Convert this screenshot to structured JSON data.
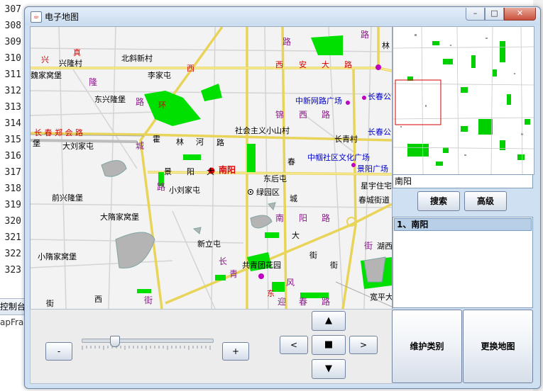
{
  "background": {
    "line_numbers": [
      "307",
      "308",
      "309",
      "310",
      "311",
      "312",
      "313",
      "314",
      "315",
      "316",
      "317",
      "318",
      "319",
      "320",
      "321",
      "322",
      "323"
    ],
    "tab_label": "控制台",
    "tab_label_2": "apFrame"
  },
  "window": {
    "title": "电子地图",
    "minimize_glyph": "–",
    "maximize_glyph": "□",
    "close_glyph": "✕"
  },
  "map": {
    "labels": [
      {
        "t": "真",
        "c": "red"
      },
      {
        "t": "北斜新村",
        "c": ""
      },
      {
        "t": "路",
        "c": "road"
      },
      {
        "t": "路",
        "c": "road"
      },
      {
        "t": "林",
        "c": ""
      },
      {
        "t": "兴",
        "c": "red"
      },
      {
        "t": "兴隆村",
        "c": ""
      },
      {
        "t": "西",
        "c": "red"
      },
      {
        "t": "西",
        "c": "red"
      },
      {
        "t": "安",
        "c": "red"
      },
      {
        "t": "大",
        "c": "red"
      },
      {
        "t": "路",
        "c": "red"
      },
      {
        "t": "魏家窝堡",
        "c": ""
      },
      {
        "t": "李家屯",
        "c": ""
      },
      {
        "t": "隆",
        "c": "road"
      },
      {
        "t": "东兴隆堡",
        "c": ""
      },
      {
        "t": "路",
        "c": "road"
      },
      {
        "t": "环",
        "c": "red"
      },
      {
        "t": "中新网路广场",
        "c": "blue"
      },
      {
        "t": "长春公",
        "c": "blue"
      },
      {
        "t": "锦",
        "c": "road"
      },
      {
        "t": "西",
        "c": "road"
      },
      {
        "t": "路",
        "c": "road"
      },
      {
        "t": "长 春 郑 会 路",
        "c": "red"
      },
      {
        "t": "霍",
        "c": ""
      },
      {
        "t": "林",
        "c": ""
      },
      {
        "t": "河",
        "c": ""
      },
      {
        "t": "路",
        "c": ""
      },
      {
        "t": "社会主义小山村",
        "c": ""
      },
      {
        "t": "堡",
        "c": ""
      },
      {
        "t": "大刘家屯",
        "c": ""
      },
      {
        "t": "城",
        "c": "road"
      },
      {
        "t": "长青村",
        "c": ""
      },
      {
        "t": "长春公",
        "c": "blue"
      },
      {
        "t": "春",
        "c": ""
      },
      {
        "t": "中帼社区文化广场",
        "c": "blue"
      },
      {
        "t": "景",
        "c": ""
      },
      {
        "t": "阳",
        "c": ""
      },
      {
        "t": "大",
        "c": ""
      },
      {
        "t": "南阳",
        "c": "big"
      },
      {
        "t": "东后屯",
        "c": ""
      },
      {
        "t": "景阳广场",
        "c": "blue"
      },
      {
        "t": "路",
        "c": "road"
      },
      {
        "t": "小刘家屯",
        "c": ""
      },
      {
        "t": "绿园区",
        "c": ""
      },
      {
        "t": "星宇住宅",
        "c": ""
      },
      {
        "t": "前兴隆堡",
        "c": ""
      },
      {
        "t": "城",
        "c": ""
      },
      {
        "t": "春城街道",
        "c": ""
      },
      {
        "t": "大隋家窝堡",
        "c": ""
      },
      {
        "t": "南",
        "c": "road"
      },
      {
        "t": "阳",
        "c": "road"
      },
      {
        "t": "路",
        "c": "road"
      },
      {
        "t": "大",
        "c": ""
      },
      {
        "t": "新立屯",
        "c": ""
      },
      {
        "t": "街",
        "c": "road"
      },
      {
        "t": "湖西",
        "c": ""
      },
      {
        "t": "小隋家窝堡",
        "c": ""
      },
      {
        "t": "长",
        "c": "road"
      },
      {
        "t": "街",
        "c": ""
      },
      {
        "t": "青",
        "c": "road"
      },
      {
        "t": "共青团花园",
        "c": ""
      },
      {
        "t": "街",
        "c": ""
      },
      {
        "t": "街",
        "c": ""
      },
      {
        "t": "西",
        "c": ""
      },
      {
        "t": "街",
        "c": "road"
      },
      {
        "t": "东",
        "c": "red"
      },
      {
        "t": "风",
        "c": "road"
      },
      {
        "t": "迎",
        "c": "road"
      },
      {
        "t": "春",
        "c": "road"
      },
      {
        "t": "路",
        "c": "road"
      },
      {
        "t": "宽平大",
        "c": ""
      }
    ]
  },
  "search": {
    "value": "南阳",
    "search_button": "搜索",
    "advanced_button": "高级"
  },
  "results": {
    "items": [
      "1、南阳"
    ]
  },
  "controls": {
    "zoom_out": "-",
    "zoom_in": "+",
    "zoom_level": 0.25,
    "pan_up": "▲",
    "pan_left": "<",
    "pan_center": "■",
    "pan_right": ">",
    "pan_down": "▼"
  },
  "actions": {
    "maintain_category": "维护类别",
    "change_map": "更换地图"
  },
  "colors": {
    "highway": "#e9d45a",
    "park": "#00e000",
    "water": "#b4b4b4",
    "selection": "#b8cfe8",
    "overview_box": "#d00000"
  }
}
